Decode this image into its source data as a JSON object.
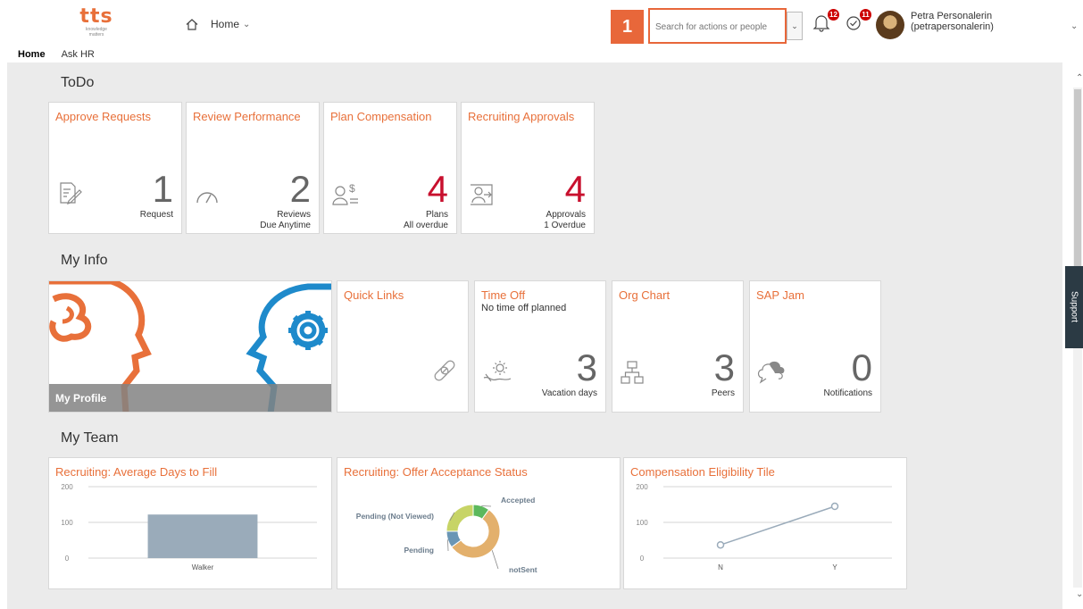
{
  "header": {
    "logo_text": "tts",
    "logo_tagline_1": "knowledge",
    "logo_tagline_2": "matters",
    "home_label": "Home",
    "step_number": "1",
    "search_placeholder": "Search for actions or people",
    "notifications_count": "12",
    "tasks_count": "11",
    "user_name": "Petra Personalerin",
    "user_id": "(petrapersonalerin)"
  },
  "subnav": {
    "home": "Home",
    "ask_hr": "Ask HR"
  },
  "todo": {
    "title": "ToDo",
    "tiles": [
      {
        "title": "Approve Requests",
        "number": "1",
        "unit1": "Request",
        "unit2": ""
      },
      {
        "title": "Review Performance",
        "number": "2",
        "unit1": "Reviews",
        "unit2": "Due Anytime"
      },
      {
        "title": "Plan Compensation",
        "number": "4",
        "unit1": "Plans",
        "unit2": "All overdue"
      },
      {
        "title": "Recruiting Approvals",
        "number": "4",
        "unit1": "Approvals",
        "unit2": "1 Overdue"
      }
    ]
  },
  "myinfo": {
    "title": "My Info",
    "profile_label": "My Profile",
    "quick_links": "Quick Links",
    "time_off": {
      "title": "Time Off",
      "subtitle": "No time off planned",
      "number": "3",
      "unit": "Vacation days"
    },
    "org_chart": {
      "title": "Org Chart",
      "number": "3",
      "unit": "Peers"
    },
    "sap_jam": {
      "title": "SAP Jam",
      "number": "0",
      "unit": "Notifications"
    }
  },
  "myteam": {
    "title": "My Team",
    "tile1_title": "Recruiting: Average Days to Fill",
    "tile2_title": "Recruiting: Offer Acceptance Status",
    "tile3_title": "Compensation Eligibility Tile"
  },
  "support_label": "Support",
  "chart_data": [
    {
      "type": "bar",
      "title": "Recruiting: Average Days to Fill",
      "categories": [
        "Walker"
      ],
      "values": [
        122
      ],
      "ylim": [
        0,
        200
      ],
      "yticks": [
        "200",
        "100",
        "0"
      ],
      "color": "#9aabba"
    },
    {
      "type": "pie",
      "title": "Recruiting: Offer Acceptance Status",
      "labels": [
        "Accepted",
        "notSent",
        "Pending",
        "Pending (Not Viewed)"
      ],
      "values": [
        10,
        55,
        10,
        25
      ],
      "colors": [
        "#5cb85c",
        "#e3b06c",
        "#6a96b5",
        "#c7d466"
      ]
    },
    {
      "type": "line",
      "title": "Compensation Eligibility Tile",
      "categories": [
        "N",
        "Y"
      ],
      "values": [
        37,
        145
      ],
      "ylim": [
        0,
        200
      ],
      "yticks": [
        "200",
        "100",
        "0"
      ],
      "color": "#9aabba"
    }
  ]
}
